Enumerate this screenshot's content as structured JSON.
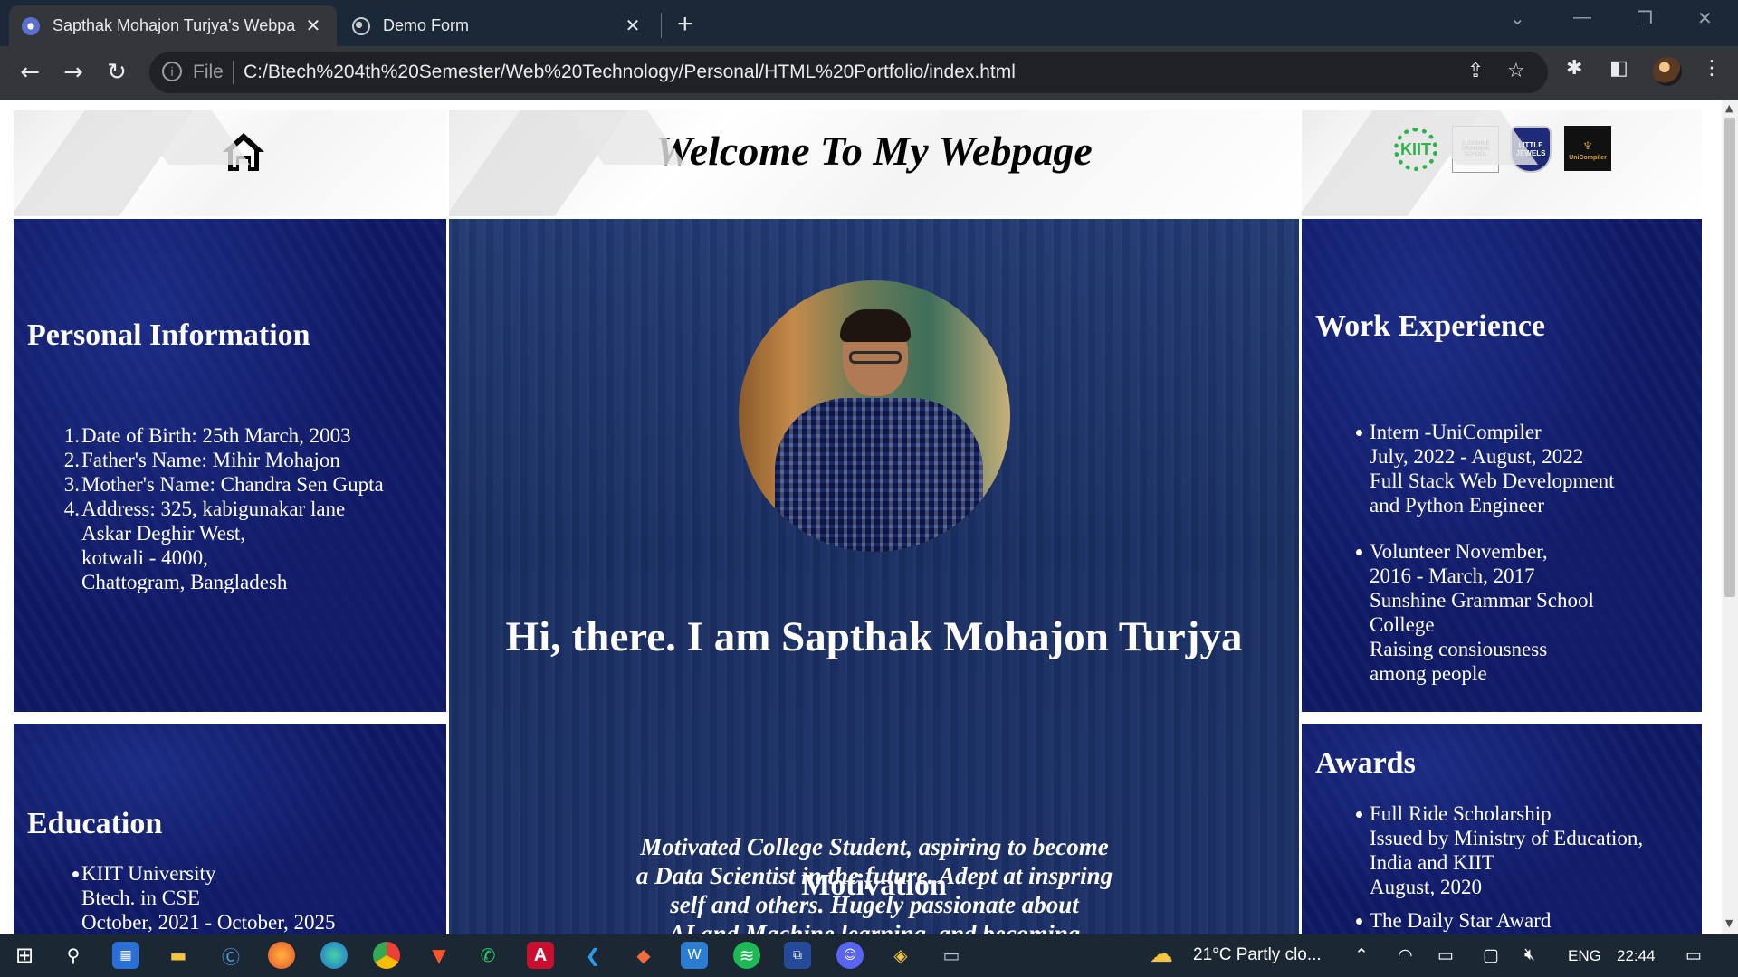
{
  "browser": {
    "tabs": [
      {
        "title": "Sapthak Mohajon Turjya's Webpa",
        "active": true
      },
      {
        "title": "Demo Form",
        "active": false
      }
    ],
    "omnibox": {
      "scheme_label": "File",
      "url": "C:/Btech%204th%20Semester/Web%20Technology/Personal/HTML%20Portfolio/index.html"
    }
  },
  "page": {
    "title": "Welcome To My Webpage",
    "personal": {
      "heading": "Personal Information",
      "items": [
        {
          "num": "1.",
          "lines": [
            "Date of Birth: 25th March, 2003"
          ]
        },
        {
          "num": "2.",
          "lines": [
            "Father's Name: Mihir Mohajon"
          ]
        },
        {
          "num": "3.",
          "lines": [
            "Mother's Name: Chandra Sen Gupta"
          ]
        },
        {
          "num": "4.",
          "lines": [
            "Address: 325, kabigunakar lane",
            "Askar Deghir West,",
            "kotwali - 4000,",
            "Chattogram, Bangladesh"
          ]
        }
      ]
    },
    "education": {
      "heading": "Education",
      "items": [
        {
          "lines": [
            "KIIT University",
            "Btech. in CSE",
            "October, 2021 - October, 2025"
          ]
        }
      ]
    },
    "intro": {
      "greeting": "Hi, there. I am Sapthak Mohajon Turjya",
      "motivation_heading": "Motivation",
      "motivation_lines": [
        "Motivated College Student, aspiring to become",
        "a Data Scientist in the future. Adept at inspring",
        "self and others. Hugely passionate about",
        "AI and Machine learning, and becoming"
      ]
    },
    "work": {
      "heading": "Work Experience",
      "items": [
        {
          "lines": [
            "Intern -UniCompiler",
            "July, 2022 - August, 2022",
            "Full Stack Web Development",
            "and Python Engineer"
          ]
        },
        {
          "lines": [
            "Volunteer November,",
            "2016 - March, 2017",
            "Sunshine Grammar School",
            "College",
            "Raising consiousness",
            "among people"
          ]
        }
      ]
    },
    "awards": {
      "heading": "Awards",
      "items": [
        {
          "lines": [
            "Full Ride Scholarship",
            "Issued by Ministry of Education,",
            "India and KIIT",
            "August, 2020"
          ]
        },
        {
          "lines": [
            "The Daily Star Award"
          ]
        }
      ]
    },
    "logos": [
      {
        "icon": "kiit-logo",
        "text": "KIIT"
      },
      {
        "icon": "sunshine-grammar-school-logo",
        "text": "SUNSHINE GRAMMAR SCHOOL"
      },
      {
        "icon": "little-jewels-logo",
        "text": "LITTLE JEWELS"
      },
      {
        "icon": "unicompiler-logo",
        "text": "UniCompiler"
      }
    ]
  },
  "taskbar": {
    "weather": "21°C  Partly clo...",
    "language": "ENG",
    "time": "22:44"
  },
  "colors": {
    "header_bg": "#f3f3f3",
    "panel_blue": "#0f1a66",
    "wood_blue": "#1f3468",
    "chrome": "#35363a",
    "taskbar": "#1c2734"
  }
}
